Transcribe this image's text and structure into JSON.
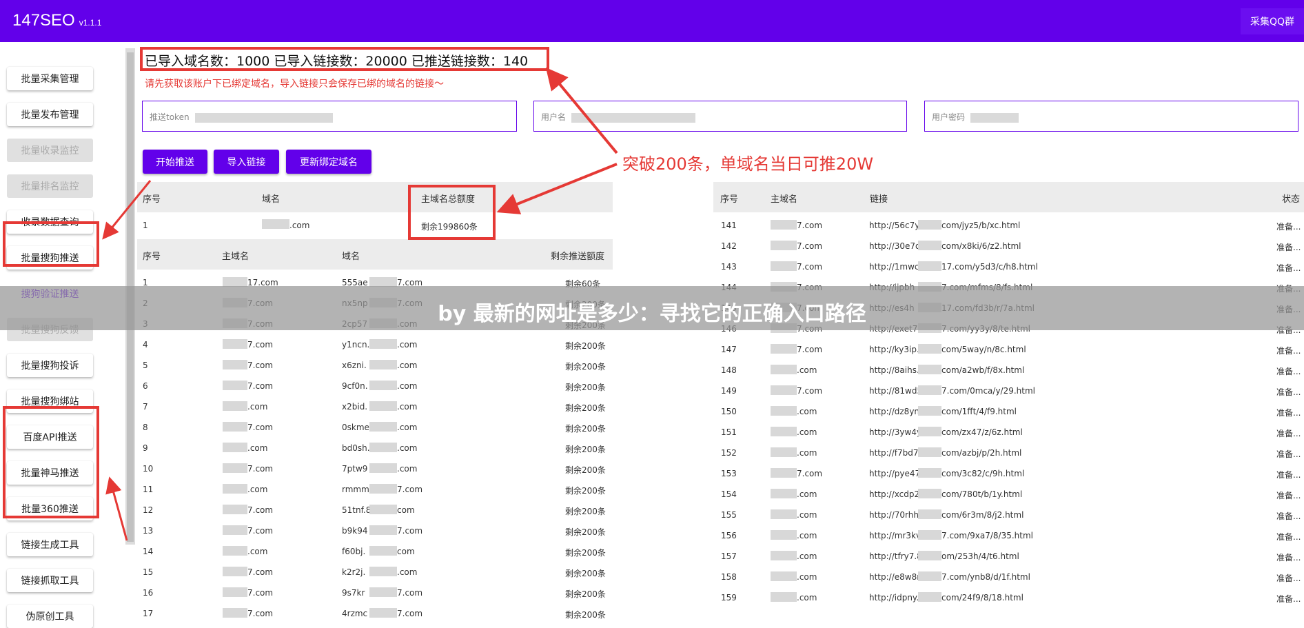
{
  "app": {
    "brand": "147SEO",
    "version": "v1.1.1",
    "qq_button": "采集QQ群"
  },
  "sidebar": {
    "items": [
      {
        "label": "批量采集管理",
        "state": "normal"
      },
      {
        "label": "批量发布管理",
        "state": "normal"
      },
      {
        "label": "批量收录监控",
        "state": "disabled"
      },
      {
        "label": "批量排名监控",
        "state": "disabled"
      },
      {
        "label": "收录数据查询",
        "state": "normal"
      },
      {
        "label": "批量搜狗推送",
        "state": "active"
      },
      {
        "label": "搜狗验证推送",
        "state": "link"
      },
      {
        "label": "批量搜狗反馈",
        "state": "disabled"
      },
      {
        "label": "批量搜狗投诉",
        "state": "normal"
      },
      {
        "label": "批量搜狗绑站",
        "state": "normal"
      },
      {
        "label": "百度API推送",
        "state": "normal"
      },
      {
        "label": "批量神马推送",
        "state": "normal"
      },
      {
        "label": "批量360推送",
        "state": "normal"
      },
      {
        "label": "链接生成工具",
        "state": "normal"
      },
      {
        "label": "链接抓取工具",
        "state": "normal"
      },
      {
        "label": "伪原创工具",
        "state": "normal"
      }
    ]
  },
  "summary": "已导入域名数：1000 已导入链接数：20000 已推送链接数：140",
  "warning": "请先获取该账户下已绑定域名，导入链接只会保存已绑的域名的链接～",
  "fields": {
    "token": "推送token",
    "username": "用户名",
    "password": "用户密码"
  },
  "buttons": {
    "start": "开始推送",
    "import": "导入链接",
    "update": "更新绑定域名"
  },
  "annotation": "突破200条，单域名当日可推20W",
  "quota_table": {
    "headers": [
      "序号",
      "域名",
      "主域名总额度"
    ],
    "rows": [
      {
        "no": "1",
        "domain": ".com",
        "quota": "剩余199860条"
      }
    ]
  },
  "domain_table": {
    "headers": [
      "序号",
      "主域名",
      "域名",
      "剩余推送额度"
    ],
    "rows": [
      {
        "no": "1",
        "main": "17.com",
        "domain": "555ae",
        "domain_tail": "7.com",
        "remain": "剩余60条"
      },
      {
        "no": "2",
        "main": "7.com",
        "domain": "nx5np",
        "domain_tail": "7.com",
        "remain": "剩余200条"
      },
      {
        "no": "3",
        "main": "7.com",
        "domain": "2cp57",
        "domain_tail": ".com",
        "remain": "剩余200条"
      },
      {
        "no": "4",
        "main": "7.com",
        "domain": "y1ncn.",
        "domain_tail": ".com",
        "remain": "剩余200条"
      },
      {
        "no": "5",
        "main": "7.com",
        "domain": "x6zni.",
        "domain_tail": ".com",
        "remain": "剩余200条"
      },
      {
        "no": "6",
        "main": "7.com",
        "domain": "9cf0n.",
        "domain_tail": ".com",
        "remain": "剩余200条"
      },
      {
        "no": "7",
        "main": ".com",
        "domain": "x2bid.",
        "domain_tail": ".com",
        "remain": "剩余200条"
      },
      {
        "no": "8",
        "main": "7.com",
        "domain": "0skme",
        "domain_tail": ".com",
        "remain": "剩余200条"
      },
      {
        "no": "9",
        "main": ".com",
        "domain": "bd0sh.",
        "domain_tail": ".com",
        "remain": "剩余200条"
      },
      {
        "no": "10",
        "main": "7.com",
        "domain": "7ptw9",
        "domain_tail": ".com",
        "remain": "剩余200条"
      },
      {
        "no": "11",
        "main": ".com",
        "domain": "rmmm6",
        "domain_tail": "7.com",
        "remain": "剩余200条"
      },
      {
        "no": "12",
        "main": "7.com",
        "domain": "51tnf.8",
        "domain_tail": "com",
        "remain": "剩余200条"
      },
      {
        "no": "13",
        "main": "7.com",
        "domain": "b9k94",
        "domain_tail": "7.com",
        "remain": "剩余200条"
      },
      {
        "no": "14",
        "main": ".com",
        "domain": "f60bj.",
        "domain_tail": "com",
        "remain": "剩余200条"
      },
      {
        "no": "15",
        "main": "7.com",
        "domain": "k2r2j.",
        "domain_tail": ".com",
        "remain": "剩余200条"
      },
      {
        "no": "16",
        "main": "7.com",
        "domain": "9s7kr",
        "domain_tail": "7.com",
        "remain": "剩余200条"
      },
      {
        "no": "17",
        "main": "7.com",
        "domain": "4rzmc",
        "domain_tail": "7.com",
        "remain": "剩余200条"
      }
    ]
  },
  "link_table": {
    "headers": [
      "序号",
      "主域名",
      "链接",
      "状态"
    ],
    "rows": [
      {
        "no": "141",
        "main": "7.com",
        "link": "http://56c7y.",
        "link_tail": "com/jyz5/b/xc.html",
        "status": "准备..."
      },
      {
        "no": "142",
        "main": "7.com",
        "link": "http://30e7d",
        "link_tail": "com/x8ki/6/z2.html",
        "status": "准备..."
      },
      {
        "no": "143",
        "main": "7.com",
        "link": "http://1mwc",
        "link_tail": "17.com/y5d3/c/h8.html",
        "status": "准备..."
      },
      {
        "no": "144",
        "main": "7.com",
        "link": "http://ijpbh",
        "link_tail": "7.com/mfms/8/fs.html",
        "status": "准备..."
      },
      {
        "no": "145",
        "main": "7.com",
        "link": "http://es4h",
        "link_tail": "17.com/fd3b/r/7a.html",
        "status": "准备..."
      },
      {
        "no": "146",
        "main": "7.com",
        "link": "http://exet7",
        "link_tail": "7.com/yy3y/8/te.html",
        "status": "准备..."
      },
      {
        "no": "147",
        "main": "7.com",
        "link": "http://ky3ip.",
        "link_tail": "com/5way/n/8c.html",
        "status": "准备..."
      },
      {
        "no": "148",
        "main": ".com",
        "link": "http://8aihs.",
        "link_tail": "com/a2wb/f/8x.html",
        "status": "准备..."
      },
      {
        "no": "149",
        "main": "7.com",
        "link": "http://81wd5",
        "link_tail": "7.com/0mca/y/29.html",
        "status": "准备..."
      },
      {
        "no": "150",
        "main": ".com",
        "link": "http://dz8yn.",
        "link_tail": "com/1fft/4/f9.html",
        "status": "准备..."
      },
      {
        "no": "151",
        "main": ".com",
        "link": "http://3yw4y",
        "link_tail": "com/zx47/z/6z.html",
        "status": "准备..."
      },
      {
        "no": "152",
        "main": ".com",
        "link": "http://f7bd7.",
        "link_tail": "com/azbj/p/2h.html",
        "status": "准备..."
      },
      {
        "no": "153",
        "main": "7.com",
        "link": "http://pye47.",
        "link_tail": "com/3c82/c/9h.html",
        "status": "准备..."
      },
      {
        "no": "154",
        "main": ".com",
        "link": "http://xcdp2",
        "link_tail": "com/780t/b/1y.html",
        "status": "准备..."
      },
      {
        "no": "155",
        "main": ".com",
        "link": "http://70rhh.",
        "link_tail": "com/6r3m/8/j2.html",
        "status": "准备..."
      },
      {
        "no": "156",
        "main": ".com",
        "link": "http://mr3kv",
        "link_tail": "7.com/9xa7/8/35.html",
        "status": "准备..."
      },
      {
        "no": "157",
        "main": ".com",
        "link": "http://tfry7.8",
        "link_tail": "om/253h/4/t6.html",
        "status": "准备..."
      },
      {
        "no": "158",
        "main": ".com",
        "link": "http://e8w8r",
        "link_tail": "7.com/ynb8/d/1f.html",
        "status": "准备..."
      },
      {
        "no": "159",
        "main": ".com",
        "link": "http://idpny.",
        "link_tail": "com/24f9/8/18.html",
        "status": "准备..."
      }
    ]
  },
  "overlay_banner": "by 最新的网址是多少：寻找它的正确入口路径",
  "colors": {
    "primary": "#6200ea",
    "annotation": "#e53935"
  }
}
